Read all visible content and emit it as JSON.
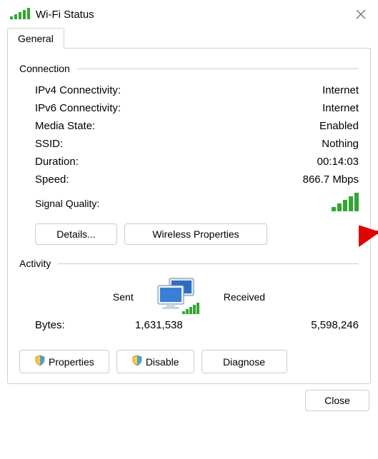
{
  "title": "Wi-Fi Status",
  "tabs": [
    {
      "label": "General"
    }
  ],
  "connection": {
    "heading": "Connection",
    "rows": [
      {
        "label": "IPv4 Connectivity:",
        "value": "Internet"
      },
      {
        "label": "IPv6 Connectivity:",
        "value": "Internet"
      },
      {
        "label": "Media State:",
        "value": "Enabled"
      },
      {
        "label": "SSID:",
        "value": "Nothing"
      },
      {
        "label": "Duration:",
        "value": "00:14:03"
      },
      {
        "label": "Speed:",
        "value": "866.7 Mbps"
      }
    ],
    "signal_label": "Signal Quality:",
    "buttons": {
      "details": "Details...",
      "wireless": "Wireless Properties"
    }
  },
  "activity": {
    "heading": "Activity",
    "sent_label": "Sent",
    "received_label": "Received",
    "bytes_label": "Bytes:",
    "bytes_sent": "1,631,538",
    "bytes_received": "5,598,246"
  },
  "bottom_buttons": {
    "properties": "Properties",
    "disable": "Disable",
    "diagnose": "Diagnose"
  },
  "footer": {
    "close": "Close"
  }
}
